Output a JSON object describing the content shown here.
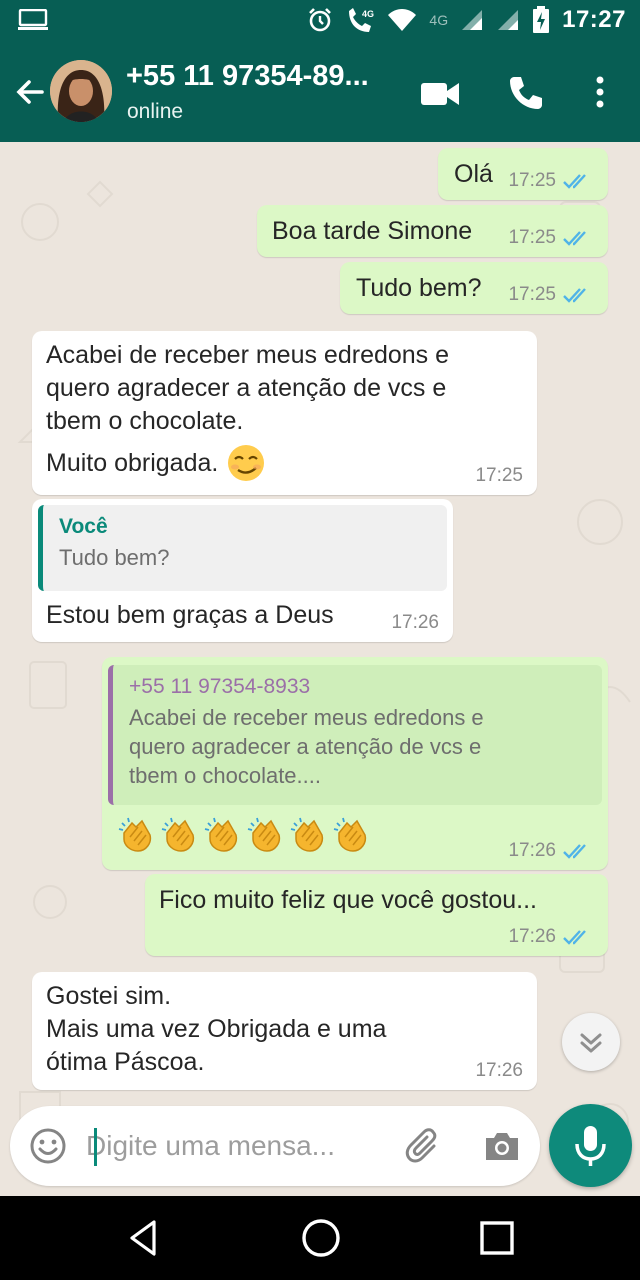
{
  "status_bar": {
    "time": "17:27",
    "network_label": "4G"
  },
  "header": {
    "contact_name": "+55 11 97354-89...",
    "contact_status": "online"
  },
  "messages": [
    {
      "direction": "outgoing",
      "text": "Olá",
      "time": "17:25",
      "read": true
    },
    {
      "direction": "outgoing",
      "text": "Boa tarde Simone",
      "time": "17:25",
      "read": true
    },
    {
      "direction": "outgoing",
      "text": "Tudo bem?",
      "time": "17:25",
      "read": true
    },
    {
      "direction": "incoming",
      "lines": [
        "Acabei de receber meus edredons e",
        "quero agradecer a atenção de vcs e",
        "tbem o chocolate.",
        "Muito obrigada."
      ],
      "emoji": "smirking-face",
      "time": "17:25"
    },
    {
      "direction": "incoming",
      "quote": {
        "author": "Você",
        "text": "Tudo bem?"
      },
      "text": "Estou bem graças a Deus",
      "time": "17:26"
    },
    {
      "direction": "outgoing",
      "quote": {
        "author": "+55 11 97354-8933",
        "lines": [
          "Acabei de receber meus edredons e",
          "quero agradecer a atenção de vcs e",
          "tbem o chocolate...."
        ]
      },
      "emoji": "clapping-hands",
      "emoji_count": 6,
      "time": "17:26",
      "read": true
    },
    {
      "direction": "outgoing",
      "text": "Fico muito feliz que você gostou...",
      "time": "17:26",
      "read": true
    },
    {
      "direction": "incoming",
      "lines": [
        "Gostei sim.",
        "Mais uma vez Obrigada e uma",
        "ótima Páscoa."
      ],
      "time": "17:26"
    }
  ],
  "input": {
    "placeholder": "Digite uma mensa..."
  },
  "colors": {
    "header": "#075e54",
    "outgoing_bubble": "#dcf8c6",
    "incoming_bubble": "#ffffff",
    "chat_background": "#ece5dd",
    "read_ticks": "#4fb3e8",
    "mic_button": "#0e8a7b",
    "quote_you": "#0a8a7a",
    "quote_contact": "#9b6fa8"
  },
  "icons": {
    "status_bar": [
      "screen-icon",
      "alarm-icon",
      "wifi-calling-icon",
      "wifi-icon",
      "signal-icon",
      "battery-charging-icon"
    ],
    "header": [
      "back-arrow-icon",
      "video-call-icon",
      "phone-call-icon",
      "more-options-icon"
    ],
    "input": [
      "emoji-icon",
      "attach-icon",
      "camera-icon",
      "mic-icon"
    ],
    "navigation": [
      "nav-back-icon",
      "nav-home-icon",
      "nav-recents-icon"
    ]
  }
}
